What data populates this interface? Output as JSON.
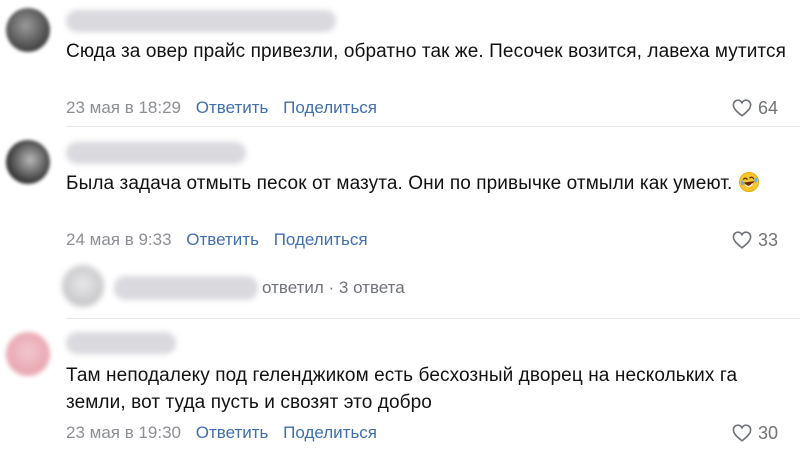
{
  "comments": [
    {
      "text": "Сюда за овер прайс привезли, обратно так же. Песочек возится, лавеха мутится",
      "date": "23 мая в 18:29",
      "reply_label": "Ответить",
      "share_label": "Поделиться",
      "likes": "64"
    },
    {
      "text": "Была задача отмыть песок от мазута. Они по привычке отмыли как умеют.",
      "date": "24 мая в 9:33",
      "reply_label": "Ответить",
      "share_label": "Поделиться",
      "likes": "33",
      "emoji": "rolling-on-floor-laughing-emoji"
    },
    {
      "text": "Там неподалеку под геленджиком есть бесхозный дворец на нескольких га земли, вот туда пусть и свозят это добро",
      "date": "23 мая в 19:30",
      "reply_label": "Ответить",
      "share_label": "Поделиться",
      "likes": "30"
    }
  ],
  "replies_summary": {
    "text": "ответил · 3 ответа"
  },
  "icons": {
    "like": "heart-outline-icon"
  },
  "colors": {
    "link": "#3f6fae",
    "meta": "#8b8e94",
    "text": "#111111"
  }
}
